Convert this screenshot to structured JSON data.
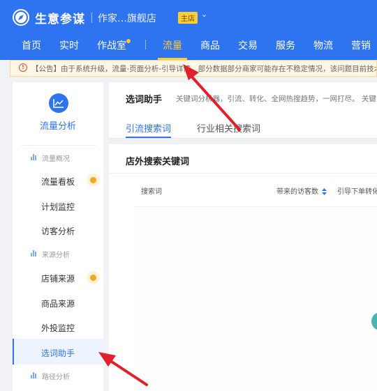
{
  "header": {
    "brand": "生意参谋",
    "shop_name": "作家…旗舰店",
    "shop_badge": "主店",
    "caret": "⌄",
    "nav": [
      {
        "label": "首页"
      },
      {
        "label": "实时"
      },
      {
        "label": "作战室"
      },
      {
        "label": "流量",
        "active": true
      },
      {
        "label": "商品"
      },
      {
        "label": "交易"
      },
      {
        "label": "服务"
      },
      {
        "label": "物流"
      },
      {
        "label": "营销"
      }
    ]
  },
  "notice": {
    "icon": "!",
    "text": "【公告】由于系统升级，流量-页面分析-引导详情，部分数据部分商家可能存在不稳定情况，该问题目前技术已经在"
  },
  "sidebar": {
    "title": "流量分析",
    "groups": [
      {
        "label": "流量概况",
        "items": [
          {
            "label": "流量看板",
            "dot": true
          },
          {
            "label": "计划监控"
          },
          {
            "label": "访客分析"
          }
        ]
      },
      {
        "label": "来源分析",
        "items": [
          {
            "label": "店铺来源",
            "dot": true
          },
          {
            "label": "商品来源"
          },
          {
            "label": "外投监控"
          },
          {
            "label": "选词助手",
            "active": true
          }
        ]
      },
      {
        "label": "路径分析",
        "items": []
      }
    ]
  },
  "main": {
    "title": "选词助手",
    "description": "关键词分析器，引流、转化、全网热搜趋势，一网打尽。 关键词",
    "tabs": [
      {
        "label": "引流搜索词",
        "active": true
      },
      {
        "label": "行业相关搜索词"
      }
    ],
    "section_title": "店外搜索关键词",
    "columns": [
      {
        "label": "搜索词"
      },
      {
        "label": "带来的访客数",
        "sortable": true
      },
      {
        "label": "引导下单转化"
      }
    ]
  },
  "colors": {
    "header_bg": "#2e73f0",
    "accent_yellow": "#ffcc33",
    "arrow_red": "#e0202a",
    "link_blue": "#2e73f0"
  }
}
